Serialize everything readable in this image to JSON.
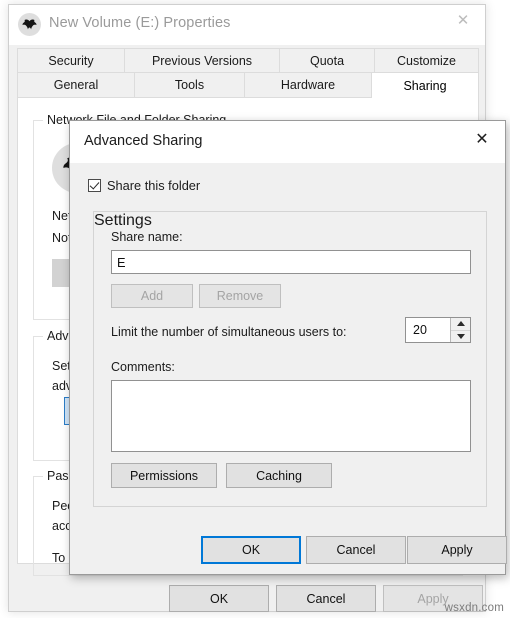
{
  "colors": {
    "accent": "#0078d7",
    "window_bg": "#f0f0f0",
    "page_bg": "#ffffff",
    "button_face": "#e1e1e1",
    "disabled_text": "#a4a4a4",
    "highlight_button_bg": "#cfe4f7",
    "highlight_button_border": "#2a7cc7"
  },
  "properties_window": {
    "title": "New Volume (E:) Properties",
    "icon": "drive-icon",
    "close_icon": "close-icon",
    "tabs_row1": [
      {
        "label": "Security",
        "selected": false
      },
      {
        "label": "Previous Versions",
        "selected": false
      },
      {
        "label": "Quota",
        "selected": false
      },
      {
        "label": "Customize",
        "selected": false
      }
    ],
    "tabs_row2": [
      {
        "label": "General",
        "selected": false
      },
      {
        "label": "Tools",
        "selected": false
      },
      {
        "label": "Hardware",
        "selected": false
      },
      {
        "label": "Sharing",
        "selected": true
      }
    ],
    "groups": {
      "network": {
        "title": "Network File and Folder Sharing",
        "line1": "Netw",
        "line2": "Not S"
      },
      "advanced": {
        "title": "Adva",
        "line1": "Set c",
        "line2": "adva",
        "button_label": ""
      },
      "password": {
        "title": "Passw",
        "line1": "Peop",
        "line2": "acce",
        "line3": "To c"
      }
    },
    "buttons": {
      "ok": "OK",
      "cancel": "Cancel",
      "apply": "Apply",
      "apply_disabled": true
    }
  },
  "advanced_sharing_dialog": {
    "title": "Advanced Sharing",
    "close_icon": "close-icon",
    "share_this_folder": {
      "label": "Share this folder",
      "checked": true
    },
    "settings": {
      "title": "Settings",
      "share_name_label": "Share name:",
      "share_name_value": "E",
      "share_name_placeholder": "",
      "add_label": "Add",
      "add_disabled": true,
      "remove_label": "Remove",
      "remove_disabled": true,
      "limit_label": "Limit the number of simultaneous users to:",
      "limit_value": "20",
      "comments_label": "Comments:",
      "comments_value": "",
      "comments_placeholder": "",
      "permissions_label": "Permissions",
      "caching_label": "Caching"
    },
    "buttons": {
      "ok": "OK",
      "cancel": "Cancel",
      "apply": "Apply"
    }
  },
  "watermark": "wsxdn.com"
}
